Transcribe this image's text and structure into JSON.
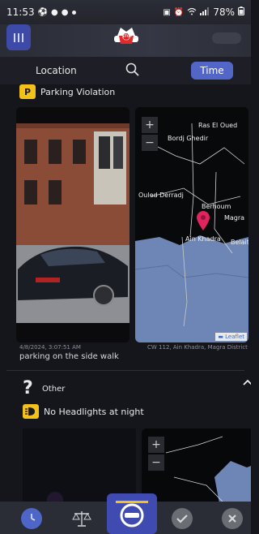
{
  "status_bar": {
    "time": "11:53",
    "battery": "78%",
    "icons": [
      "soccer-ball-icon",
      "location-pin-icon",
      "location-pin-icon",
      "dot-icon",
      "sim-icon",
      "alarm-icon",
      "wifi-icon",
      "signal-icon",
      "battery-icon"
    ]
  },
  "header": {
    "menu_icon": "menu-icon",
    "logo": "stop-hat-logo",
    "logo_text": "STOP"
  },
  "tabs": {
    "location_label": "Location",
    "search_icon": "search-icon",
    "time_label": "Time"
  },
  "report1": {
    "category_icon": "parking-sign-icon",
    "category_label": "Parking Violation",
    "timestamp": "4/8/2024, 3:07:51 AM",
    "location": "CW 112, Ain Khadra, Magra District",
    "description": "parking on the side walk",
    "map": {
      "zoom_in": "+",
      "zoom_out": "−",
      "attribution": "Leaflet",
      "places": [
        "Ras El Oued",
        "Bordj Ghedir",
        "Ouled Derradj",
        "Berhoum",
        "Magra",
        "Ain Khadra",
        "Belait"
      ],
      "marker_icon": "map-marker-icon"
    }
  },
  "report2": {
    "category_icon": "question-mark-icon",
    "category_label": "Other",
    "subcategory_icon": "headlight-icon",
    "subcategory_label": "No Headlights at night",
    "collapse_icon": "chevron-up-icon",
    "map": {
      "zoom_in": "+",
      "zoom_out": "−"
    }
  },
  "bottom_nav": {
    "items": [
      "clock-icon",
      "scales-icon",
      "camera-capture-icon",
      "check-badge-icon",
      "close-badge-icon"
    ],
    "accent": "#5266c7"
  }
}
